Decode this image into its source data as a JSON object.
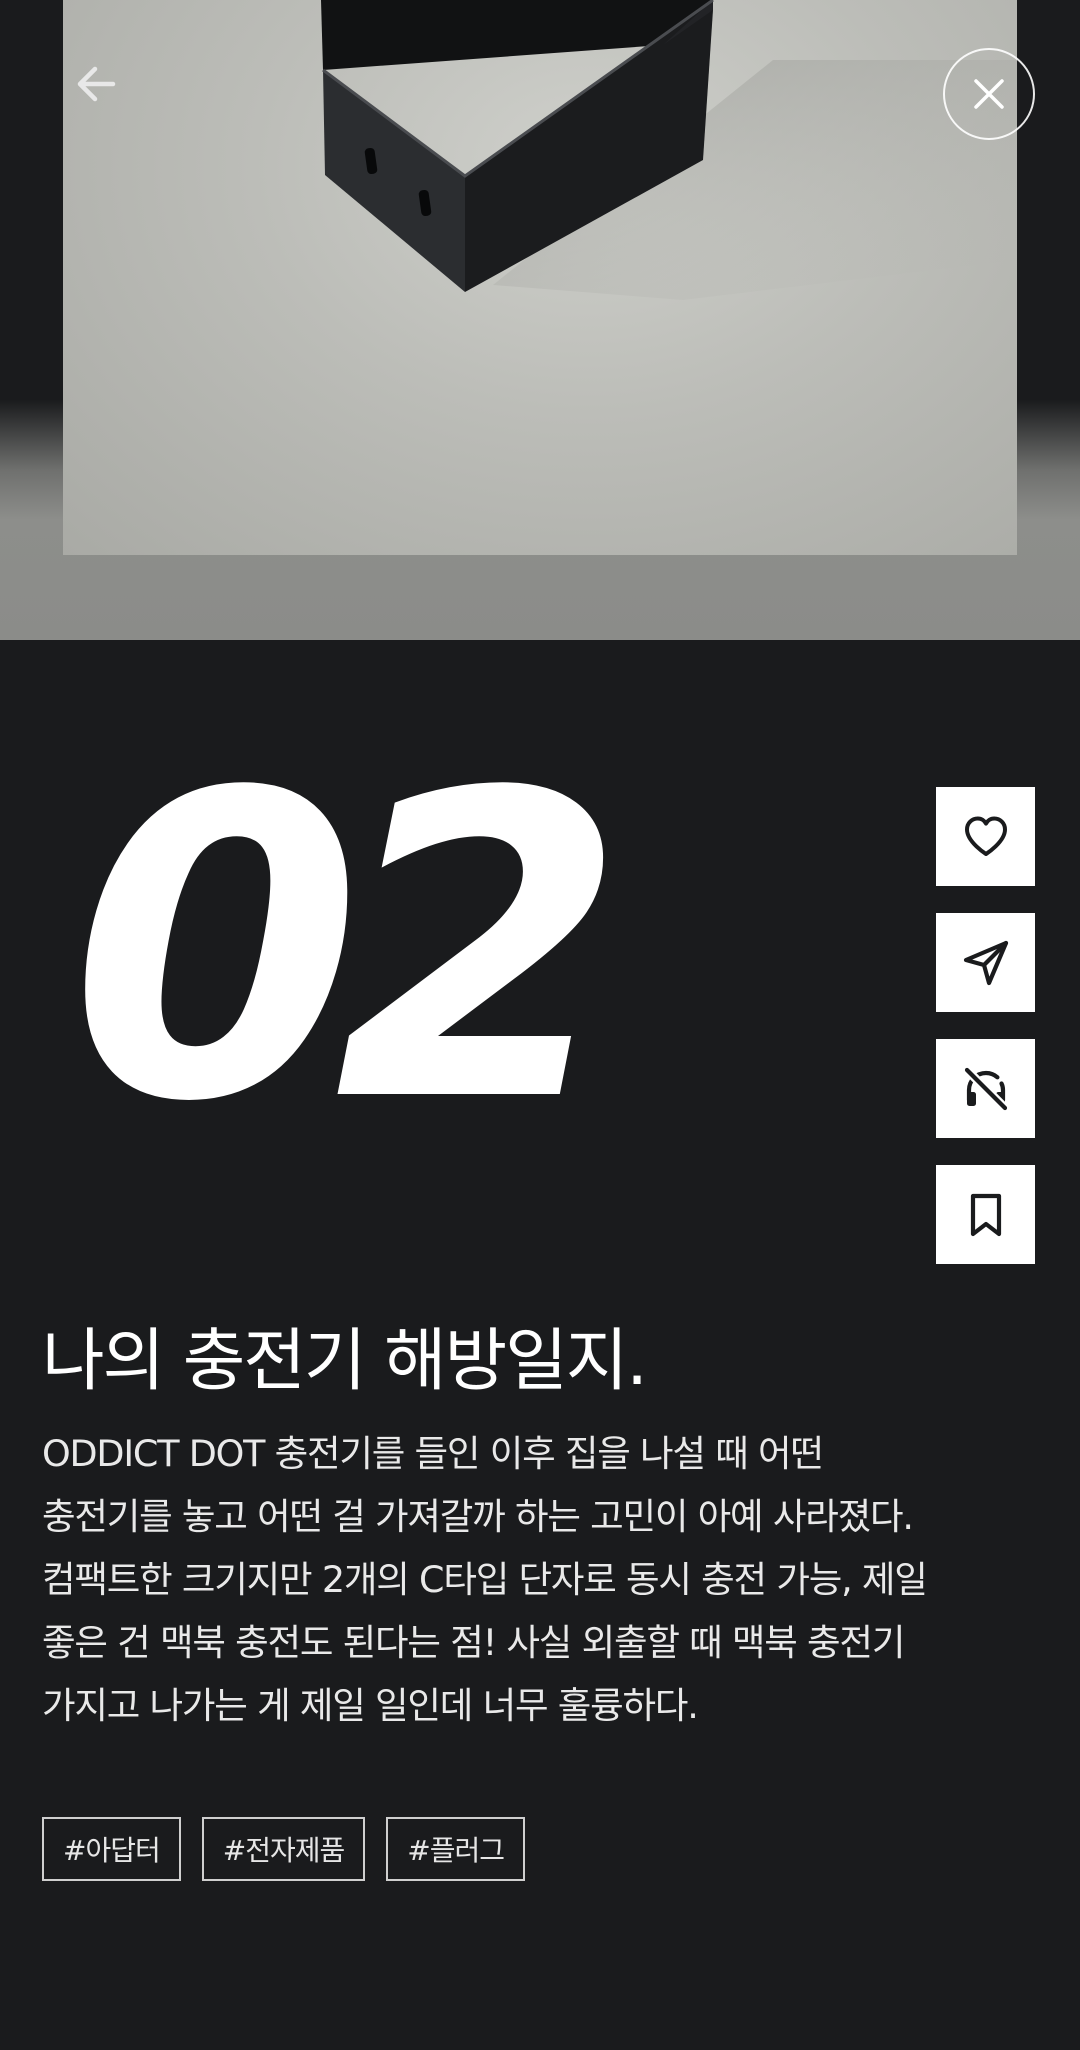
{
  "header": {
    "back_icon": "arrow-left-icon",
    "close_icon": "close-icon"
  },
  "post": {
    "number": "02",
    "title": "나의 충전기 해방일지.",
    "body_lines": [
      " ODDICT DOT 충전기를 들인 이후 집을 나설 때 어떤",
      "충전기를 놓고 어떤 걸 가져갈까 하는 고민이 아예 사라졌다.",
      "컴팩트한 크기지만 2개의 C타입 단자로 동시 충전 가능, 제일",
      "좋은 건 맥북 충전도 된다는 점! 사실 외출할 때 맥북 충전기",
      "가지고 나가는 게 제일 일인데 너무 훌륭하다."
    ],
    "tags": [
      "#아답터",
      "#전자제품",
      "#플러그"
    ]
  },
  "actions": [
    {
      "name": "like",
      "icon": "heart-icon"
    },
    {
      "name": "share",
      "icon": "send-icon"
    },
    {
      "name": "audio",
      "icon": "headphones-off-icon"
    },
    {
      "name": "bookmark",
      "icon": "bookmark-icon"
    }
  ],
  "colors": {
    "background": "#1a1b1d",
    "text": "#ffffff",
    "button_bg": "#ffffff",
    "icon": "#1a1b1d"
  }
}
